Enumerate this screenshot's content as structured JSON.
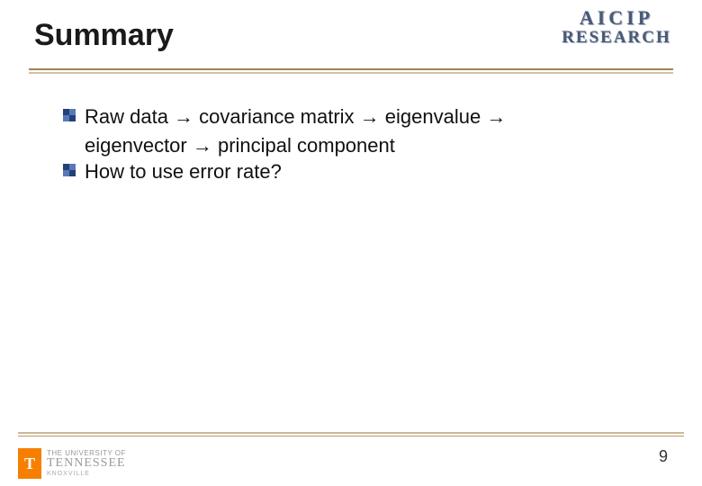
{
  "title": "Summary",
  "logo_top": {
    "line1": "AICIP",
    "line2": "RESEARCH"
  },
  "bullets": [
    {
      "line1": "Raw data  → covariance matrix → eigenvalue →",
      "line2": "eigenvector → principal component"
    },
    {
      "line1": "How to use error rate?",
      "line2": null
    }
  ],
  "footer": {
    "mark": "T",
    "the": "THE UNIVERSITY OF",
    "name": "TENNESSEE",
    "city": "KNOXVILLE"
  },
  "page_number": "9"
}
